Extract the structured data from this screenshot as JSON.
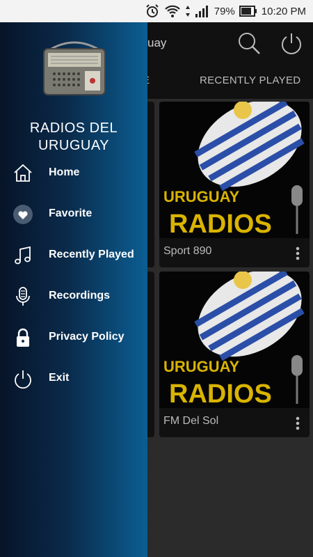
{
  "status_bar": {
    "battery": "79%",
    "time": "10:20 PM"
  },
  "app_bar": {
    "title_fragment": "uay"
  },
  "tabs": {
    "partial_tab": "E",
    "recently_played": "RECENTLY PLAYED"
  },
  "grid": {
    "cards": [
      {
        "name": "Sport 890",
        "art_line1": "URUGUAY",
        "art_line2": "RADIOS"
      },
      {
        "name": "FM Del Sol",
        "art_line1": "URUGUAY",
        "art_line2": "RADIOS"
      }
    ]
  },
  "drawer": {
    "brand_line1": "RADIOS DEL",
    "brand_line2": "URUGUAY",
    "items": [
      {
        "label": "Home",
        "icon": "home-icon"
      },
      {
        "label": "Favorite",
        "icon": "heart-icon"
      },
      {
        "label": "Recently Played",
        "icon": "music-note-icon"
      },
      {
        "label": "Recordings",
        "icon": "microphone-icon"
      },
      {
        "label": "Privacy Policy",
        "icon": "lock-icon"
      },
      {
        "label": "Exit",
        "icon": "power-icon"
      }
    ]
  },
  "colors": {
    "drawer_dark": "#071428",
    "drawer_light": "#0b5e93",
    "art_yellow": "#d9b400",
    "flag_blue": "#2b4fa8"
  }
}
